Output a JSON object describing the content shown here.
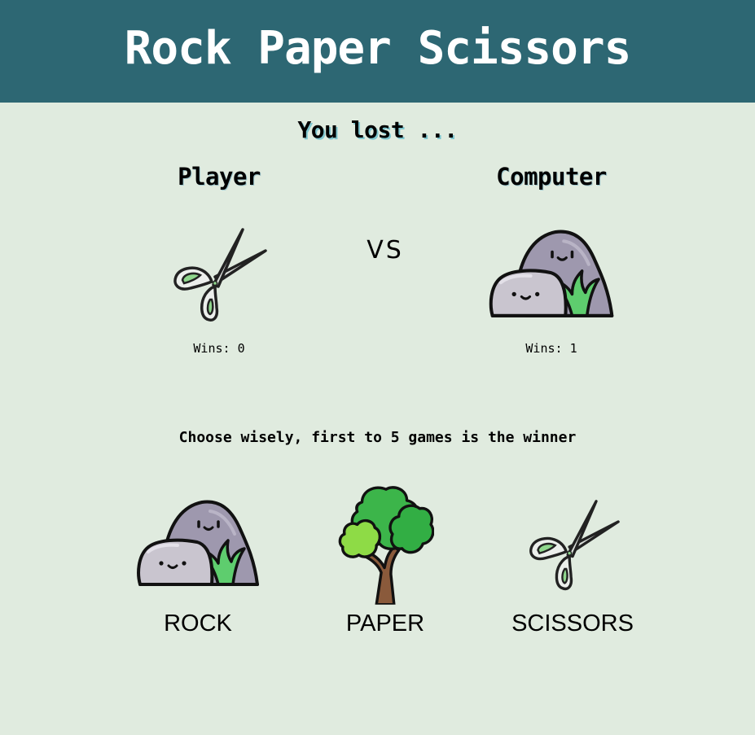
{
  "app": {
    "title": "Rock Paper Scissors"
  },
  "round": {
    "result_message": "You lost ..."
  },
  "player": {
    "title": "Player",
    "wins_label": "Wins:",
    "wins": "0",
    "pick_icon": "scissors-icon"
  },
  "computer": {
    "title": "Computer",
    "wins_label": "Wins:",
    "wins": "1",
    "pick_icon": "rock-icon"
  },
  "versus": "VS",
  "instruction": "Choose wisely, first to 5 games is the winner",
  "choices": [
    {
      "label": "ROCK",
      "icon": "rock-icon"
    },
    {
      "label": "PAPER",
      "icon": "tree-icon"
    },
    {
      "label": "SCISSORS",
      "icon": "scissors-icon"
    }
  ],
  "colors": {
    "header": "#2d6773",
    "background": "#e0ebdf",
    "rock_back": "#9e98ae",
    "rock_front": "#c9c5cf",
    "grass": "#5ecd6e",
    "tree_leaves": "#3cb54a",
    "tree_leaves_light": "#8edb46",
    "trunk": "#8a5a3b",
    "scissors_handle": "#8fd68d"
  }
}
